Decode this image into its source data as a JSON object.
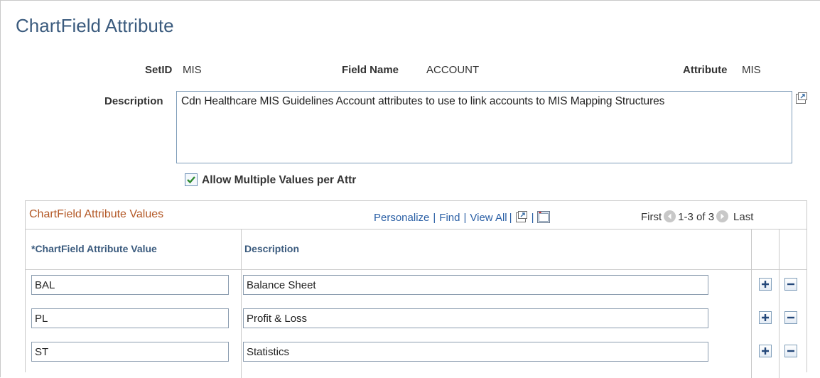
{
  "page": {
    "title": "ChartField Attribute"
  },
  "header": {
    "setid_label": "SetID",
    "setid_value": "MIS",
    "field_name_label": "Field Name",
    "field_name_value": "ACCOUNT",
    "attribute_label": "Attribute",
    "attribute_value": "MIS"
  },
  "description": {
    "label": "Description",
    "value": "Cdn Healthcare MIS Guidelines Account attributes to use to link accounts to MIS Mapping Structures"
  },
  "allow_multiple": {
    "label": "Allow Multiple Values per Attr",
    "checked": true
  },
  "grid": {
    "title": "ChartField Attribute Values",
    "nav": {
      "personalize": "Personalize",
      "find": "Find",
      "view_all": "View All",
      "sep": "|"
    },
    "pager": {
      "first": "First",
      "range": "1-3 of 3",
      "last": "Last"
    },
    "columns": [
      "*ChartField Attribute Value",
      "Description"
    ],
    "rows": [
      {
        "value": "BAL",
        "description": "Balance Sheet"
      },
      {
        "value": "PL",
        "description": "Profit & Loss"
      },
      {
        "value": "ST",
        "description": "Statistics"
      }
    ]
  },
  "icons": {
    "popup": "expand-popup-icon",
    "spreadsheet": "download-spreadsheet-icon",
    "prev": "previous-arrow-icon",
    "next": "next-arrow-icon",
    "add": "add-row-icon",
    "delete": "delete-row-icon",
    "check": "checkmark-icon"
  },
  "colors": {
    "accent": "#3b5b7e",
    "grid_title": "#b35826",
    "link": "#2a5fa5",
    "check": "#2f8a2f"
  }
}
